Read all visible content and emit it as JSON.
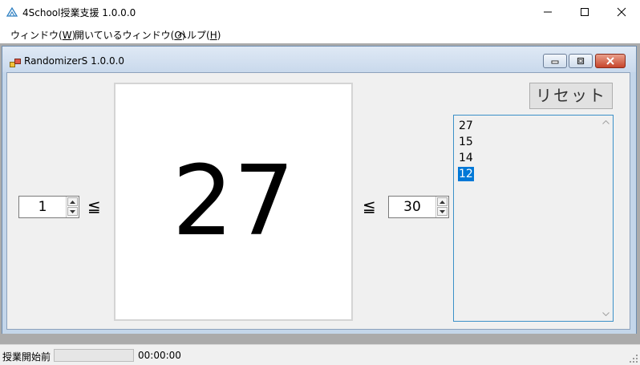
{
  "app": {
    "title": "4School授業支援 1.0.0.0"
  },
  "menu": {
    "items": [
      {
        "label": "ウィンドウ(",
        "key": "W",
        "suffix": ")"
      },
      {
        "label": "開いているウィンドウ(",
        "key": "O",
        "suffix": ")"
      },
      {
        "label": "ヘルプ(",
        "key": "H",
        "suffix": ")"
      }
    ]
  },
  "child_window": {
    "title": "RandomizerS 1.0.0.0"
  },
  "randomizer": {
    "min_value": "1",
    "max_value": "30",
    "leq_symbol": "≦",
    "result": "27",
    "reset_label": "リセット",
    "history": [
      "27",
      "15",
      "14",
      "12"
    ],
    "selected_index": 3
  },
  "status": {
    "text": "授業開始前",
    "progress": 0,
    "timer": "00:00:00"
  },
  "colors": {
    "selection": "#0078d7",
    "list_border": "#3b90c8",
    "progress_fill": "#06b025"
  },
  "icons": {
    "app": "app-icon",
    "child": "window-icon",
    "minimize": "minimize-icon",
    "maximize": "maximize-icon",
    "close": "close-icon"
  }
}
